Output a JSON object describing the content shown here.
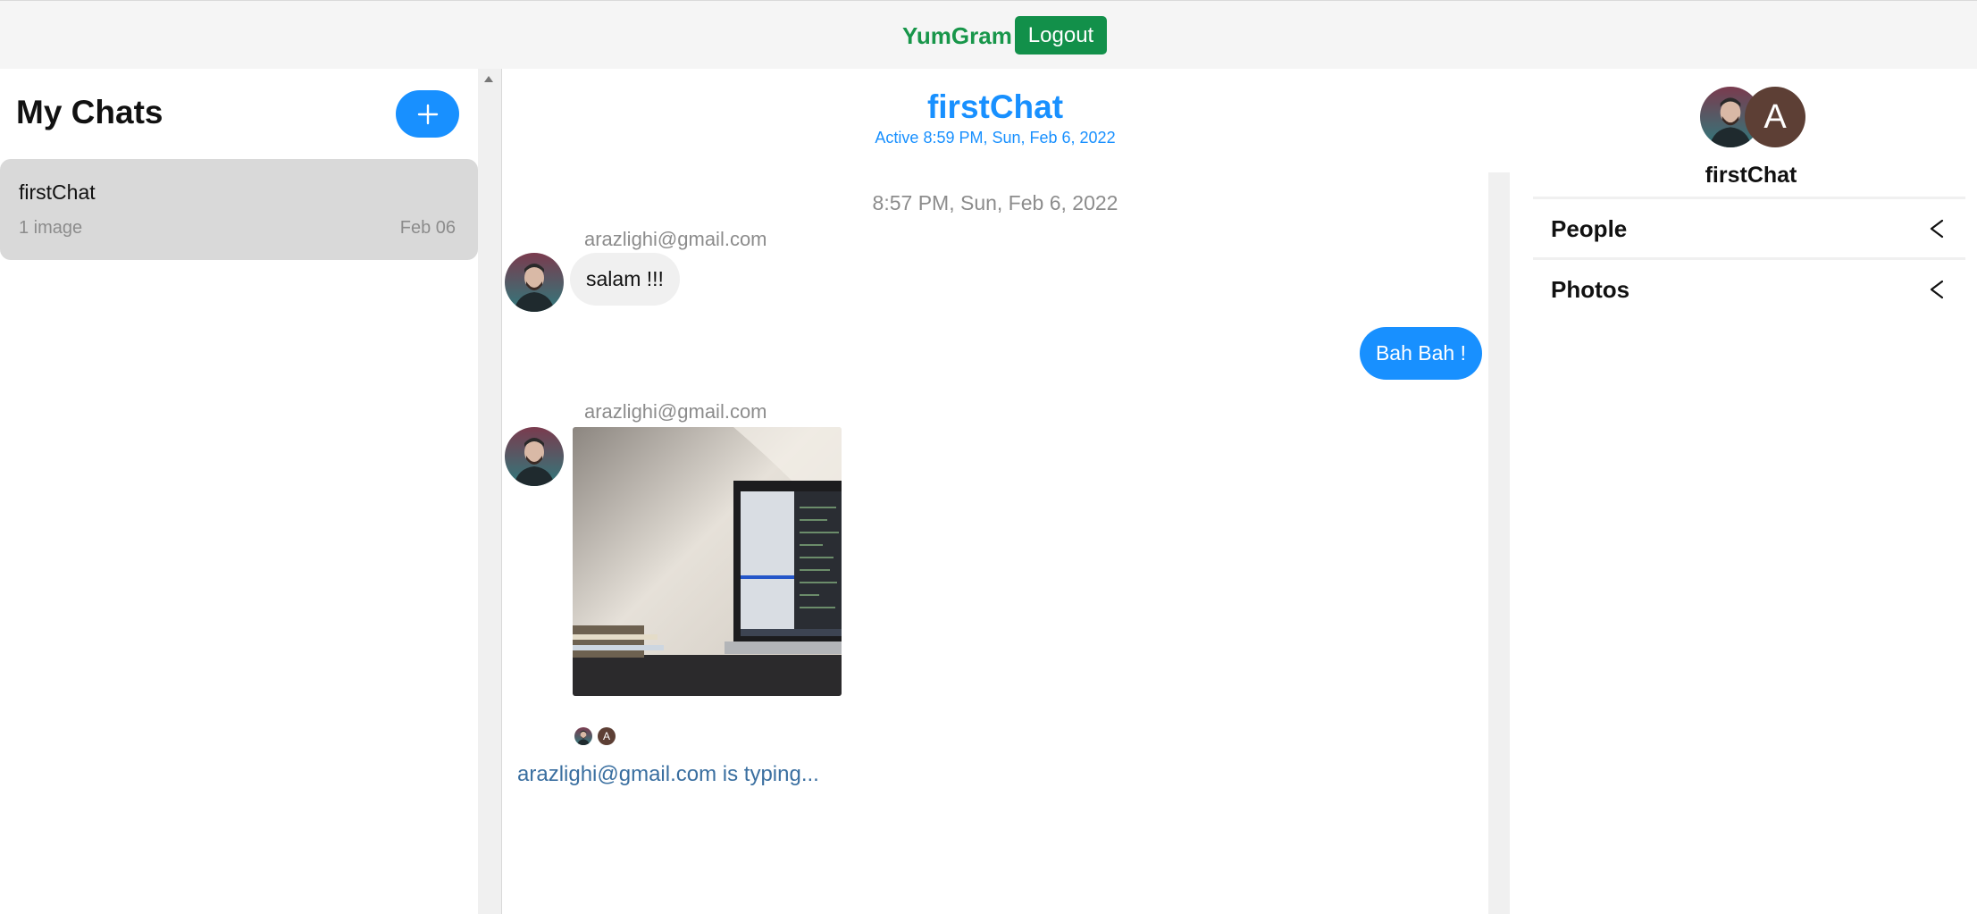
{
  "header": {
    "brand": "YumGram",
    "logout_label": "Logout"
  },
  "sidebar": {
    "title": "My Chats",
    "new_chat_icon": "plus-icon",
    "chats": [
      {
        "title": "firstChat",
        "subtitle": "1 image",
        "date": "Feb 06"
      }
    ]
  },
  "chat": {
    "title": "firstChat",
    "active": "Active 8:59 PM, Sun, Feb 6, 2022",
    "timestamp": "8:57 PM, Sun, Feb 6, 2022",
    "messages": [
      {
        "sender": "arazlighi@gmail.com",
        "text": "salam !!!",
        "direction": "in"
      },
      {
        "text": "Bah Bah !",
        "direction": "out"
      },
      {
        "sender": "arazlighi@gmail.com",
        "type": "image",
        "direction": "in"
      }
    ],
    "read_receipt_initial": "A",
    "typing": "arazlighi@gmail.com is typing..."
  },
  "details": {
    "avatar_initial": "A",
    "title": "firstChat",
    "sections": [
      {
        "label": "People",
        "icon": "chevron-left-icon"
      },
      {
        "label": "Photos",
        "icon": "chevron-left-icon"
      }
    ]
  },
  "colors": {
    "brand": "#18964a",
    "accent": "#1890ff",
    "bubble_in": "#f0f0f0",
    "avatar_brown": "#5d3f35"
  }
}
